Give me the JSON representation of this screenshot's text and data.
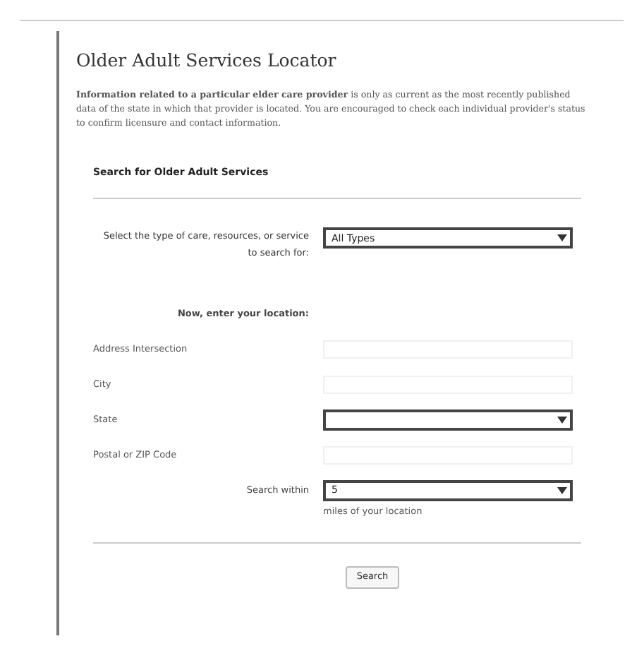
{
  "page": {
    "title": "Older Adult Services Locator",
    "intro": "**Information related to a particular elder care provider** is only as current as the most recently published data of the state in which that provider is located. You are encouraged to check each individual provider's status to confirm licensure and contact information."
  },
  "form": {
    "heading": "Search for Older Adult Services",
    "type_label": "Select the type of care, resources, or service to search for:",
    "type_value": "All Types",
    "location_heading": "Now, enter your location:",
    "fields": [
      {
        "label": "Address Intersection",
        "kind": "text"
      },
      {
        "label": "City",
        "kind": "text"
      },
      {
        "label": "State",
        "kind": "select"
      },
      {
        "label": "Postal or ZIP Code",
        "kind": "text"
      }
    ],
    "radius_label": "Search within",
    "radius_value": "5",
    "radius_hint": "miles of your location",
    "submit": "Search"
  }
}
